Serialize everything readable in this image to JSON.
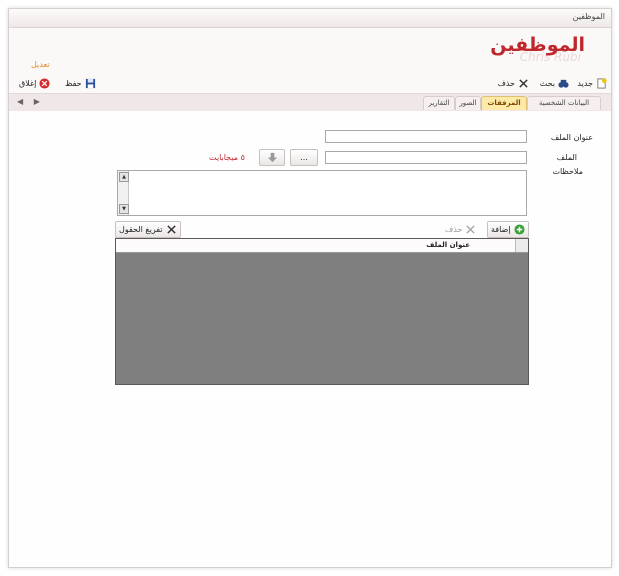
{
  "window": {
    "title": "الموظفين"
  },
  "header": {
    "title": "الموظفين",
    "subtitle_shadow": "Chris Rubi",
    "mode_label": "تعديل"
  },
  "toolbar": {
    "new_label": "جديد",
    "search_label": "بحث",
    "delete_label": "حذف",
    "save_label": "حفظ",
    "close_label": "إغلاق"
  },
  "nav": {
    "arrows": "◀ ▶"
  },
  "tabs": [
    {
      "label": "البيانات الشخصية"
    },
    {
      "label": "المرفقات"
    },
    {
      "label": "الصور"
    },
    {
      "label": "التقارير"
    }
  ],
  "form": {
    "file_title_label": "عنوان الملف",
    "file_label": "الملف",
    "notes_label": "ملاحظات",
    "browse_label": "...",
    "size_note": "٥ ميجابايت",
    "file_title_value": "",
    "file_value": "",
    "notes_value": ""
  },
  "actions": {
    "add_label": "إضافة",
    "delete_label": "حذف",
    "clear_label": "تفريغ الحقول"
  },
  "grid": {
    "columns": [
      "عنوان الملف"
    ]
  },
  "colors": {
    "accent": "#c0272d",
    "active_tab": "#fde9a8",
    "grid_bg": "#7f7f7f"
  }
}
